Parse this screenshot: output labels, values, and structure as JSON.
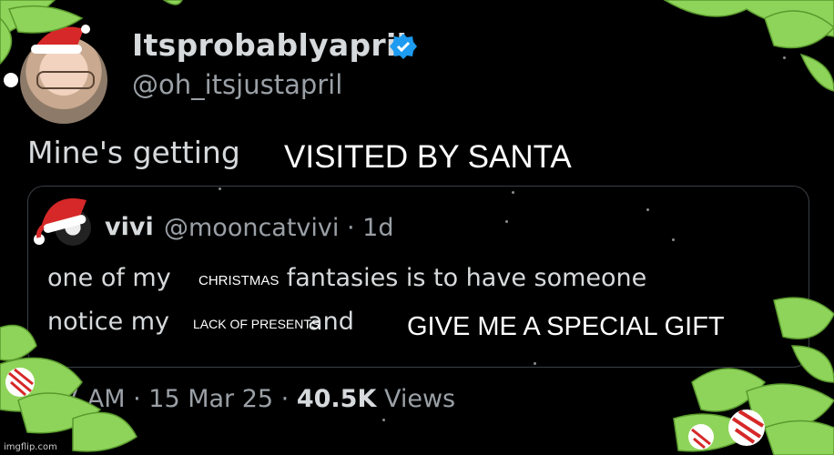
{
  "tweet": {
    "display_name": "Itsprobablyapril",
    "handle": "@oh_itsjustapril",
    "text": "Mine's getting",
    "overlay_text": "VISITED BY SANTA"
  },
  "quote": {
    "name": "vivi",
    "handle_time": "@mooncatvivi · 1d",
    "line1_before": "one of my",
    "line1_after": "fantasies is to have someone",
    "line2_before": "notice my",
    "line2_after": "and",
    "overlay_christmas": "CHRISTMAS",
    "overlay_lack": "LACK OF PRESENTS",
    "overlay_gift": "GIVE ME A SPECIAL GIFT"
  },
  "footer": {
    "time": "7 AM · 15 Mar 25 · ",
    "views_count": "40.5K",
    "views_label": "Views"
  },
  "watermark": "imgflip.com",
  "colors": {
    "background": "#000000",
    "verified": "#1d9bf0",
    "holly": "#8fd45a",
    "santa_hat": "#d62828"
  },
  "icons": [
    "verified-badge-icon",
    "santa-hat-icon",
    "holly-leaf-icon",
    "candy-cane-icon"
  ]
}
